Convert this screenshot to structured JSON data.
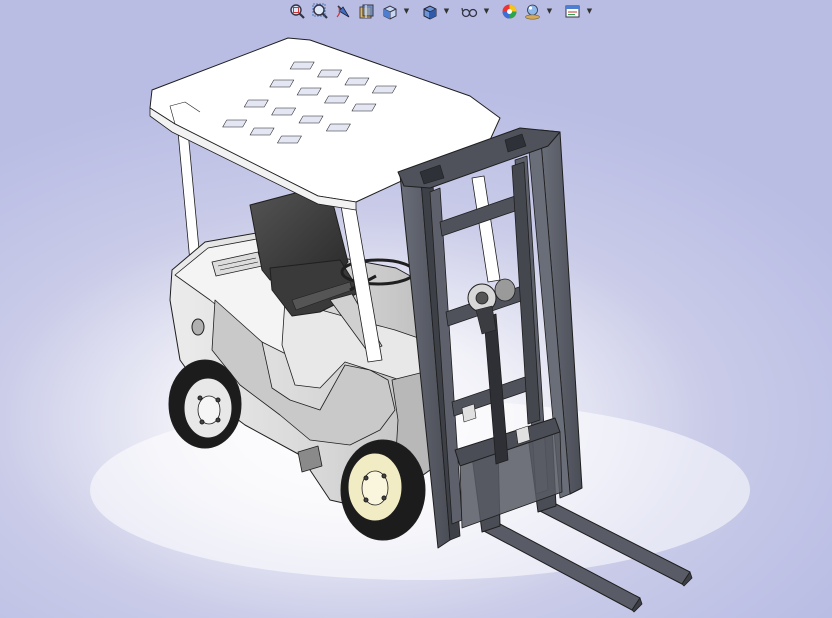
{
  "app": {
    "type": "3D CAD viewport",
    "model_subject": "forklift",
    "background_colors": {
      "top": "#b9bde4",
      "center": "#ffffff"
    }
  },
  "heads_up_toolbar": {
    "buttons": [
      {
        "icon": "zoom-to-fit-icon",
        "has_dropdown": false
      },
      {
        "icon": "zoom-to-area-icon",
        "has_dropdown": false
      },
      {
        "icon": "previous-view-icon",
        "has_dropdown": false
      },
      {
        "icon": "section-view-icon",
        "has_dropdown": false
      },
      {
        "icon": "view-orientation-icon",
        "has_dropdown": true
      },
      {
        "icon": "display-style-icon",
        "has_dropdown": true
      },
      {
        "icon": "hide-show-items-icon",
        "has_dropdown": true
      },
      {
        "icon": "edit-appearance-icon",
        "has_dropdown": false
      },
      {
        "icon": "apply-scene-icon",
        "has_dropdown": true
      },
      {
        "icon": "view-settings-icon",
        "has_dropdown": true
      }
    ]
  },
  "model_colors": {
    "canopy": "#ffffff",
    "body": "#dcdcdc",
    "mast": "#595c66",
    "seat": "#3a3a3a",
    "tire": "#1c1c1c",
    "rim_front": "#f2ecc4",
    "rim_rear": "#e8e8e8",
    "outline": "#1f1f1f"
  }
}
